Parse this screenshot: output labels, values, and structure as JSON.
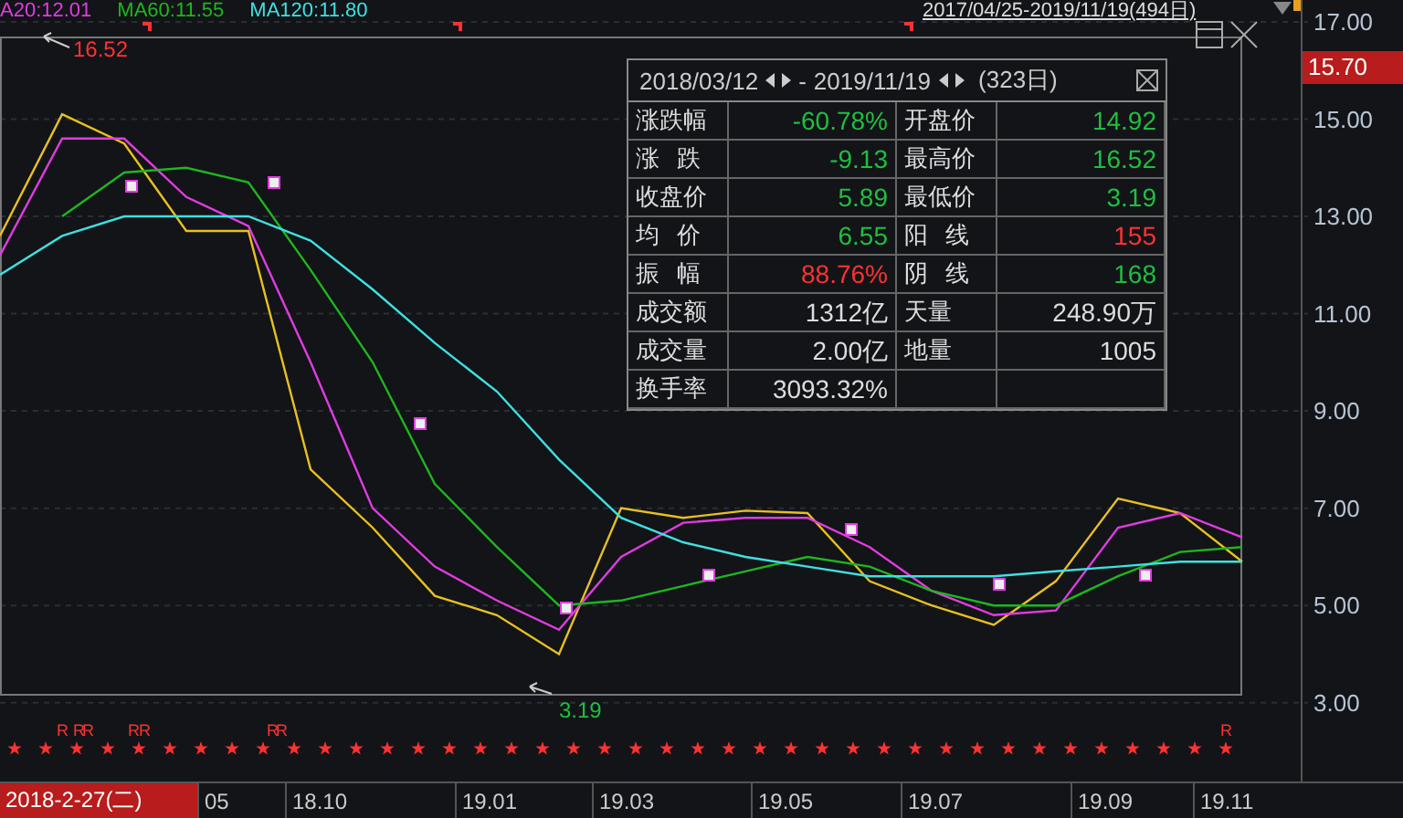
{
  "legend": [
    {
      "label": "A20:12.01",
      "color": "#e03ce0"
    },
    {
      "label": "MA60:11.55",
      "color": "#1fb51f"
    },
    {
      "label": "MA120:11.80",
      "color": "#3fe0e0"
    }
  ],
  "range_link": "2017/04/25-2019/11/19(494日)",
  "price_tag": "15.70",
  "high_label": "16.52",
  "low_label": "3.19",
  "r_marks": [
    "R",
    "R",
    "R",
    "R",
    "R",
    "R",
    "R",
    "R"
  ],
  "info_panel": {
    "start": "2018/03/12",
    "separator": "-",
    "end": "2019/11/19",
    "days": "(323日)",
    "rows": [
      [
        {
          "label": "涨跌幅",
          "value": "-60.78%",
          "color": "#1fbf3f"
        },
        {
          "label": "开盘价",
          "value": "14.92",
          "color": "#1fbf3f"
        }
      ],
      [
        {
          "label": "涨 跌",
          "value": "-9.13",
          "color": "#1fbf3f"
        },
        {
          "label": "最高价",
          "value": "16.52",
          "color": "#1fbf3f"
        }
      ],
      [
        {
          "label": "收盘价",
          "value": "5.89",
          "color": "#1fbf3f"
        },
        {
          "label": "最低价",
          "value": "3.19",
          "color": "#1fbf3f"
        }
      ],
      [
        {
          "label": "均 价",
          "value": "6.55",
          "color": "#1fbf3f"
        },
        {
          "label": "阳 线",
          "value": "155",
          "color": "#ff3232"
        }
      ],
      [
        {
          "label": "振 幅",
          "value": "88.76%",
          "color": "#ff3232"
        },
        {
          "label": "阴 线",
          "value": "168",
          "color": "#1fbf3f"
        }
      ],
      [
        {
          "label": "成交额",
          "value": "1312亿",
          "color": "#dddddd"
        },
        {
          "label": "天量",
          "value": "248.90万",
          "color": "#dddddd"
        }
      ],
      [
        {
          "label": "成交量",
          "value": "2.00亿",
          "color": "#dddddd"
        },
        {
          "label": "地量",
          "value": "1005",
          "color": "#dddddd"
        }
      ],
      [
        {
          "label": "换手率",
          "value": "3093.32%",
          "color": "#dddddd"
        }
      ]
    ]
  },
  "date_badge": "2018-2-27(二)",
  "time_axis": [
    "05",
    "18.10",
    "19.01",
    "19.03",
    "19.05",
    "19.07",
    "19.09",
    "19.11"
  ],
  "chart_data": {
    "type": "line",
    "grid": true,
    "ylim": [
      1.38,
      17.45
    ],
    "yticks": [
      {
        "value": 3,
        "label": "3.00"
      },
      {
        "value": 5,
        "label": "5.00"
      },
      {
        "value": 7,
        "label": "7.00"
      },
      {
        "value": 9,
        "label": "9.00"
      },
      {
        "value": 11,
        "label": "11.00"
      },
      {
        "value": 13,
        "label": "13.00"
      },
      {
        "value": 15,
        "label": "15.00"
      },
      {
        "value": 17,
        "label": "17.00"
      }
    ],
    "series": [
      {
        "color": "#e8c020",
        "values": [
          12.6,
          15.1,
          14.5,
          12.7,
          12.7,
          7.8,
          6.6,
          5.2,
          4.8,
          4.0,
          7.0,
          6.8,
          6.95,
          6.9,
          5.5,
          5.0,
          4.6,
          5.5,
          7.2,
          6.9,
          5.9
        ]
      },
      {
        "color": "#e03ce0",
        "values": [
          12.2,
          14.6,
          14.6,
          13.4,
          12.8,
          10.0,
          7.0,
          5.8,
          5.1,
          4.5,
          6.0,
          6.7,
          6.8,
          6.8,
          6.2,
          5.3,
          4.8,
          4.9,
          6.6,
          6.9,
          6.4
        ]
      },
      {
        "color": "#1fb51f",
        "values": [
          null,
          13.0,
          13.9,
          14.0,
          13.7,
          11.9,
          10.0,
          7.5,
          6.2,
          5.0,
          5.1,
          5.4,
          5.7,
          6.0,
          5.8,
          5.3,
          5.0,
          5.0,
          5.6,
          6.1,
          6.2
        ]
      },
      {
        "color": "#3fe0e0",
        "values": [
          11.8,
          12.6,
          13.0,
          13.0,
          13.0,
          12.5,
          11.5,
          10.4,
          9.4,
          8.0,
          6.8,
          6.3,
          6.0,
          5.8,
          5.6,
          5.6,
          5.6,
          5.7,
          5.8,
          5.9,
          5.9
        ]
      }
    ]
  }
}
